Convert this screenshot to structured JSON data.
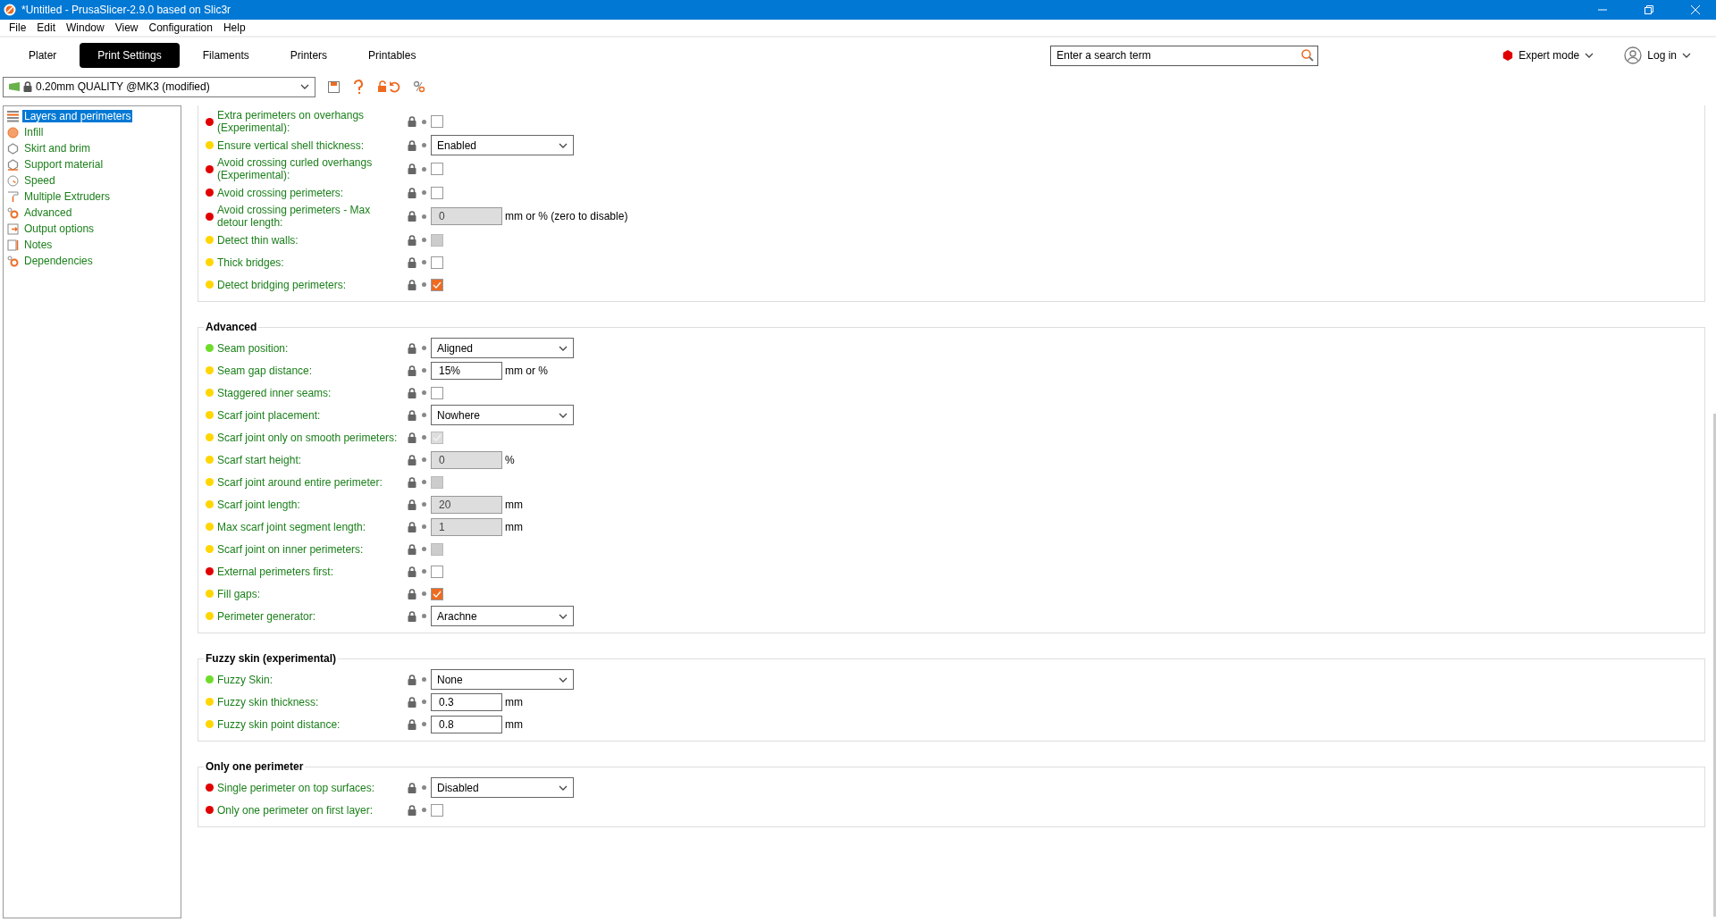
{
  "window": {
    "title": "*Untitled - PrusaSlicer-2.9.0 based on Slic3r"
  },
  "menu": [
    "File",
    "Edit",
    "Window",
    "View",
    "Configuration",
    "Help"
  ],
  "tabs": [
    {
      "label": "Plater",
      "selected": false
    },
    {
      "label": "Print Settings",
      "selected": true
    },
    {
      "label": "Filaments",
      "selected": false
    },
    {
      "label": "Printers",
      "selected": false
    },
    {
      "label": "Printables",
      "selected": false
    }
  ],
  "search": {
    "placeholder": "Enter a search term"
  },
  "mode": {
    "label": "Expert mode",
    "color": "#e00000"
  },
  "login": {
    "label": "Log in"
  },
  "preset": {
    "value": "0.20mm QUALITY @MK3 (modified)"
  },
  "sidebar": {
    "items": [
      {
        "label": "Layers and perimeters",
        "selected": true
      },
      {
        "label": "Infill",
        "selected": false
      },
      {
        "label": "Skirt and brim",
        "selected": false
      },
      {
        "label": "Support material",
        "selected": false
      },
      {
        "label": "Speed",
        "selected": false
      },
      {
        "label": "Multiple Extruders",
        "selected": false
      },
      {
        "label": "Advanced",
        "selected": false
      },
      {
        "label": "Output options",
        "selected": false
      },
      {
        "label": "Notes",
        "selected": false
      },
      {
        "label": "Dependencies",
        "selected": false
      }
    ]
  },
  "groups": [
    {
      "options": [
        {
          "label": "Extra perimeters on overhangs (Experimental):",
          "color": "#e00000",
          "kind": "checkbox",
          "checked": false,
          "disabled": false
        },
        {
          "label": "Ensure vertical shell thickness:",
          "color": "#ffd600",
          "kind": "select",
          "value": "Enabled"
        },
        {
          "label": "Avoid crossing curled overhangs (Experimental):",
          "color": "#e00000",
          "kind": "checkbox",
          "checked": false,
          "disabled": false
        },
        {
          "label": "Avoid crossing perimeters:",
          "color": "#e00000",
          "kind": "checkbox",
          "checked": false,
          "disabled": false
        },
        {
          "label": "Avoid crossing perimeters - Max detour length:",
          "color": "#e00000",
          "kind": "number",
          "value": "0",
          "unit": "mm or % (zero to disable)",
          "disabled": true
        },
        {
          "label": "Detect thin walls:",
          "color": "#ffd600",
          "kind": "checkbox",
          "checked": false,
          "disabled": true
        },
        {
          "label": "Thick bridges:",
          "color": "#ffd600",
          "kind": "checkbox",
          "checked": false,
          "disabled": false
        },
        {
          "label": "Detect bridging perimeters:",
          "color": "#ffd600",
          "kind": "checkbox",
          "checked": true,
          "disabled": false
        }
      ]
    },
    {
      "title": "Advanced",
      "options": [
        {
          "label": "Seam position:",
          "color": "#6fdc2a",
          "kind": "select",
          "value": "Aligned"
        },
        {
          "label": "Seam gap distance:",
          "color": "#ffd600",
          "kind": "number",
          "value": "15%",
          "unit": "mm or %",
          "disabled": false
        },
        {
          "label": "Staggered inner seams:",
          "color": "#ffd600",
          "kind": "checkbox",
          "checked": false,
          "disabled": false
        },
        {
          "label": "Scarf joint placement:",
          "color": "#ffd600",
          "kind": "select",
          "value": "Nowhere"
        },
        {
          "label": "Scarf joint only on smooth perimeters:",
          "color": "#ffd600",
          "kind": "checkbox",
          "checked": true,
          "disabled": true
        },
        {
          "label": "Scarf start height:",
          "color": "#ffd600",
          "kind": "number",
          "value": "0",
          "unit": "%",
          "disabled": true
        },
        {
          "label": "Scarf joint around entire perimeter:",
          "color": "#ffd600",
          "kind": "checkbox",
          "checked": false,
          "disabled": true
        },
        {
          "label": "Scarf joint length:",
          "color": "#ffd600",
          "kind": "number",
          "value": "20",
          "unit": "mm",
          "disabled": true
        },
        {
          "label": "Max scarf joint segment length:",
          "color": "#ffd600",
          "kind": "number",
          "value": "1",
          "unit": "mm",
          "disabled": true
        },
        {
          "label": "Scarf joint on inner perimeters:",
          "color": "#ffd600",
          "kind": "checkbox",
          "checked": false,
          "disabled": true
        },
        {
          "label": "External perimeters first:",
          "color": "#e00000",
          "kind": "checkbox",
          "checked": false,
          "disabled": false
        },
        {
          "label": "Fill gaps:",
          "color": "#ffd600",
          "kind": "checkbox",
          "checked": true,
          "disabled": false
        },
        {
          "label": "Perimeter generator:",
          "color": "#ffd600",
          "kind": "select",
          "value": "Arachne"
        }
      ]
    },
    {
      "title": "Fuzzy skin (experimental)",
      "options": [
        {
          "label": "Fuzzy Skin:",
          "color": "#6fdc2a",
          "kind": "select",
          "value": "None"
        },
        {
          "label": "Fuzzy skin thickness:",
          "color": "#ffd600",
          "kind": "number",
          "value": "0.3",
          "unit": "mm",
          "disabled": false
        },
        {
          "label": "Fuzzy skin point distance:",
          "color": "#ffd600",
          "kind": "number",
          "value": "0.8",
          "unit": "mm",
          "disabled": false
        }
      ]
    },
    {
      "title": "Only one perimeter",
      "options": [
        {
          "label": "Single perimeter on top surfaces:",
          "color": "#e00000",
          "kind": "select",
          "value": "Disabled"
        },
        {
          "label": "Only one perimeter on first layer:",
          "color": "#e00000",
          "kind": "checkbox",
          "checked": false,
          "disabled": false
        }
      ]
    }
  ]
}
